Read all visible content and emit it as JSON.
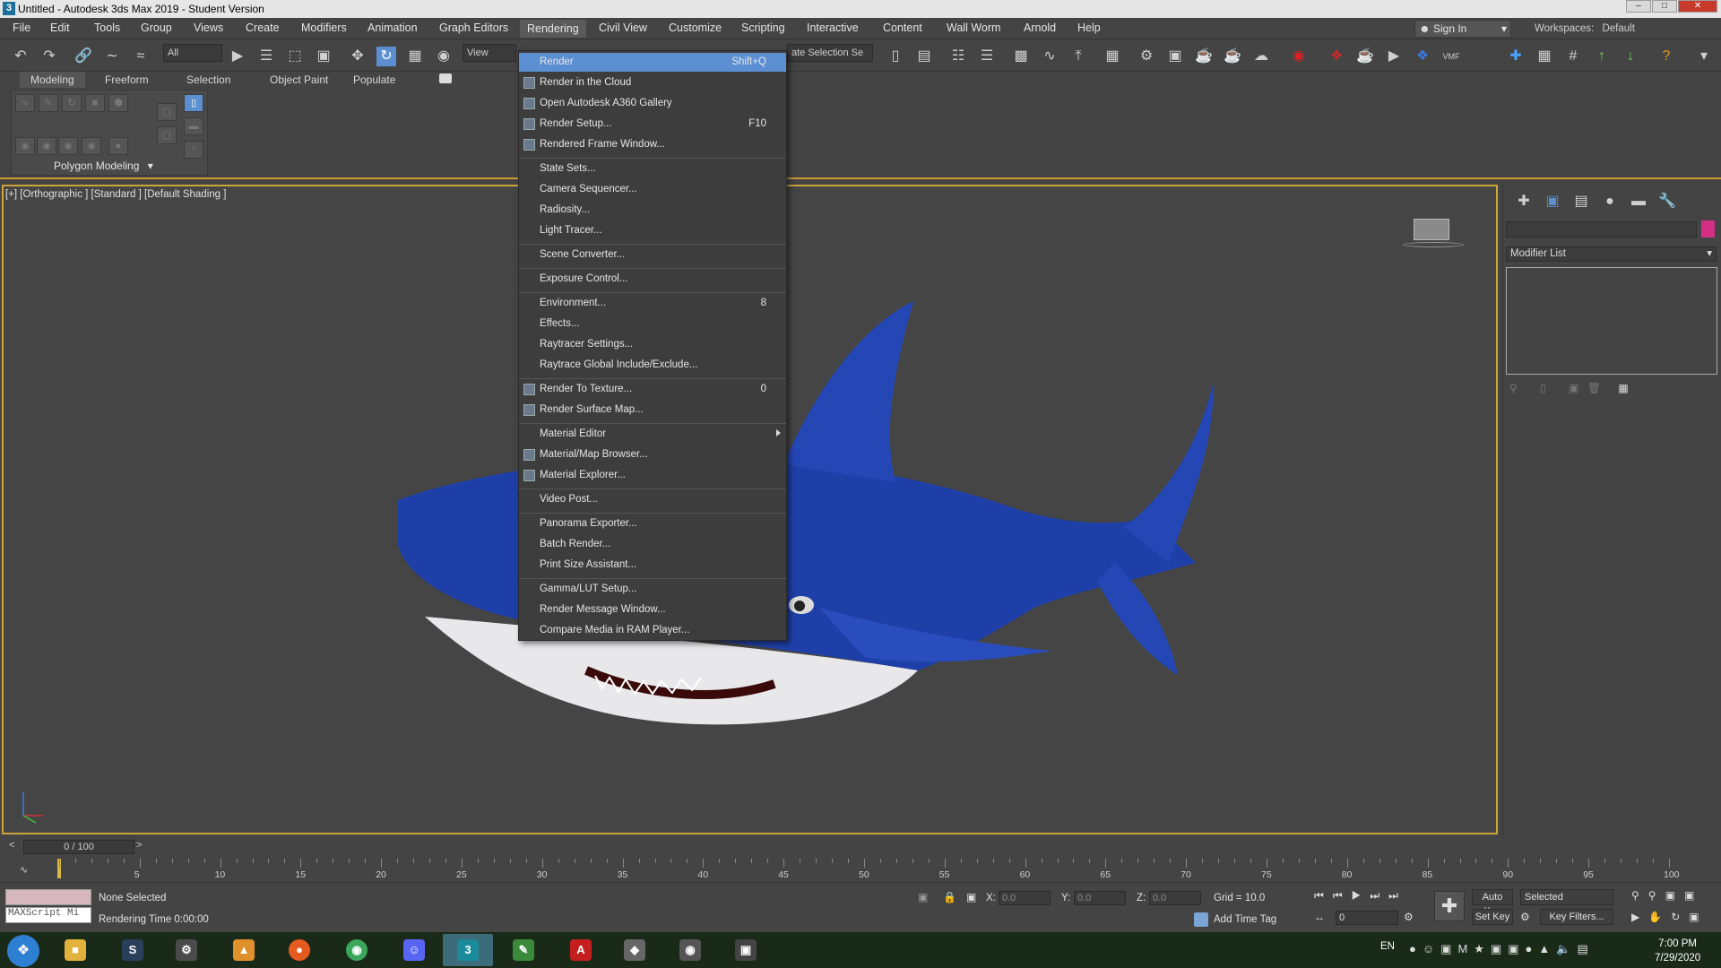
{
  "window": {
    "title": "Untitled - Autodesk 3ds Max 2019 - Student Version",
    "app_icon": "3"
  },
  "menubar": {
    "items": [
      "File",
      "Edit",
      "Tools",
      "Group",
      "Views",
      "Create",
      "Modifiers",
      "Animation",
      "Graph Editors",
      "Rendering",
      "Civil View",
      "Customize",
      "Scripting",
      "Interactive",
      "Content",
      "Wall Worm",
      "Arnold",
      "Help"
    ],
    "active": "Rendering",
    "sign_in": "Sign In",
    "workspaces_label": "Workspaces:",
    "workspaces_value": "Default"
  },
  "toolbar": {
    "selection_filter": "All",
    "reference_coord": "View",
    "named_selection": "ate Selection Se"
  },
  "ribbon": {
    "tabs": [
      "Modeling",
      "Freeform",
      "Selection",
      "Object Paint",
      "Populate"
    ],
    "selected_tab": "Modeling",
    "panel_label": "Polygon Modeling"
  },
  "viewport": {
    "label": "[+] [Orthographic ] [Standard ] [Default Shading ]"
  },
  "command_panel": {
    "modifier_list": "Modifier List",
    "object_color": "#d22e84"
  },
  "rendering_menu": [
    {
      "label": "Render",
      "shortcut": "Shift+Q",
      "icon": false,
      "highlighted": true
    },
    {
      "label": "Render in the Cloud",
      "shortcut": "",
      "icon": true
    },
    {
      "label": "Open Autodesk A360 Gallery",
      "shortcut": "",
      "icon": true
    },
    {
      "label": "Render Setup...",
      "shortcut": "F10",
      "icon": true
    },
    {
      "label": "Rendered Frame Window...",
      "shortcut": "",
      "icon": true
    },
    {
      "sep": true
    },
    {
      "label": "State Sets...",
      "shortcut": "",
      "icon": false
    },
    {
      "label": "Camera Sequencer...",
      "shortcut": "",
      "icon": false
    },
    {
      "label": "Radiosity...",
      "shortcut": "",
      "icon": false
    },
    {
      "label": "Light Tracer...",
      "shortcut": "",
      "icon": false
    },
    {
      "sep": true
    },
    {
      "label": "Scene Converter...",
      "shortcut": "",
      "icon": false
    },
    {
      "sep": true
    },
    {
      "label": "Exposure Control...",
      "shortcut": "",
      "icon": false
    },
    {
      "sep": true
    },
    {
      "label": "Environment...",
      "shortcut": "8",
      "icon": false
    },
    {
      "label": "Effects...",
      "shortcut": "",
      "icon": false
    },
    {
      "label": "Raytracer Settings...",
      "shortcut": "",
      "icon": false
    },
    {
      "label": "Raytrace Global Include/Exclude...",
      "shortcut": "",
      "icon": false
    },
    {
      "sep": true
    },
    {
      "label": "Render To Texture...",
      "shortcut": "0",
      "icon": true
    },
    {
      "label": "Render Surface Map...",
      "shortcut": "",
      "icon": true
    },
    {
      "sep": true
    },
    {
      "label": "Material Editor",
      "shortcut": "",
      "icon": false,
      "submenu": true
    },
    {
      "label": "Material/Map Browser...",
      "shortcut": "",
      "icon": true
    },
    {
      "label": "Material Explorer...",
      "shortcut": "",
      "icon": true
    },
    {
      "sep": true
    },
    {
      "label": "Video Post...",
      "shortcut": "",
      "icon": false
    },
    {
      "sep": true
    },
    {
      "label": "Panorama Exporter...",
      "shortcut": "",
      "icon": false
    },
    {
      "label": "Batch Render...",
      "shortcut": "",
      "icon": false
    },
    {
      "label": "Print Size Assistant...",
      "shortcut": "",
      "icon": false
    },
    {
      "sep": true
    },
    {
      "label": "Gamma/LUT Setup...",
      "shortcut": "",
      "icon": false
    },
    {
      "label": "Render Message Window...",
      "shortcut": "",
      "icon": false
    },
    {
      "label": "Compare Media in RAM Player...",
      "shortcut": "",
      "icon": false
    }
  ],
  "timeline": {
    "frame_display": "0 / 100",
    "tick_labels": [
      "5",
      "10",
      "15",
      "20",
      "25",
      "30",
      "35",
      "40",
      "45",
      "50",
      "55",
      "60",
      "65",
      "70",
      "75",
      "80",
      "85",
      "90",
      "95",
      "100"
    ]
  },
  "status": {
    "selection": "None Selected",
    "rendering_time": "Rendering Time  0:00:00",
    "maxscript": "MAXScript Mi",
    "x_label": "X:",
    "x_value": "0.0",
    "y_label": "Y:",
    "y_value": "0.0",
    "z_label": "Z:",
    "z_value": "0.0",
    "grid": "Grid = 10.0",
    "add_time_tag": "Add Time Tag",
    "auto_key": "Auto Key",
    "set_key": "Set Key",
    "key_mode": "Selected",
    "key_filters": "Key Filters...",
    "current_frame": "0"
  },
  "taskbar": {
    "language": "EN",
    "time": "7:00 PM",
    "date": "7/29/2020"
  },
  "colors": {
    "shark_body": "#1f3fa8",
    "shark_belly": "#e8e8ea",
    "viewport_border": "#cfa43a",
    "menu_highlight": "#5b8fd1"
  }
}
